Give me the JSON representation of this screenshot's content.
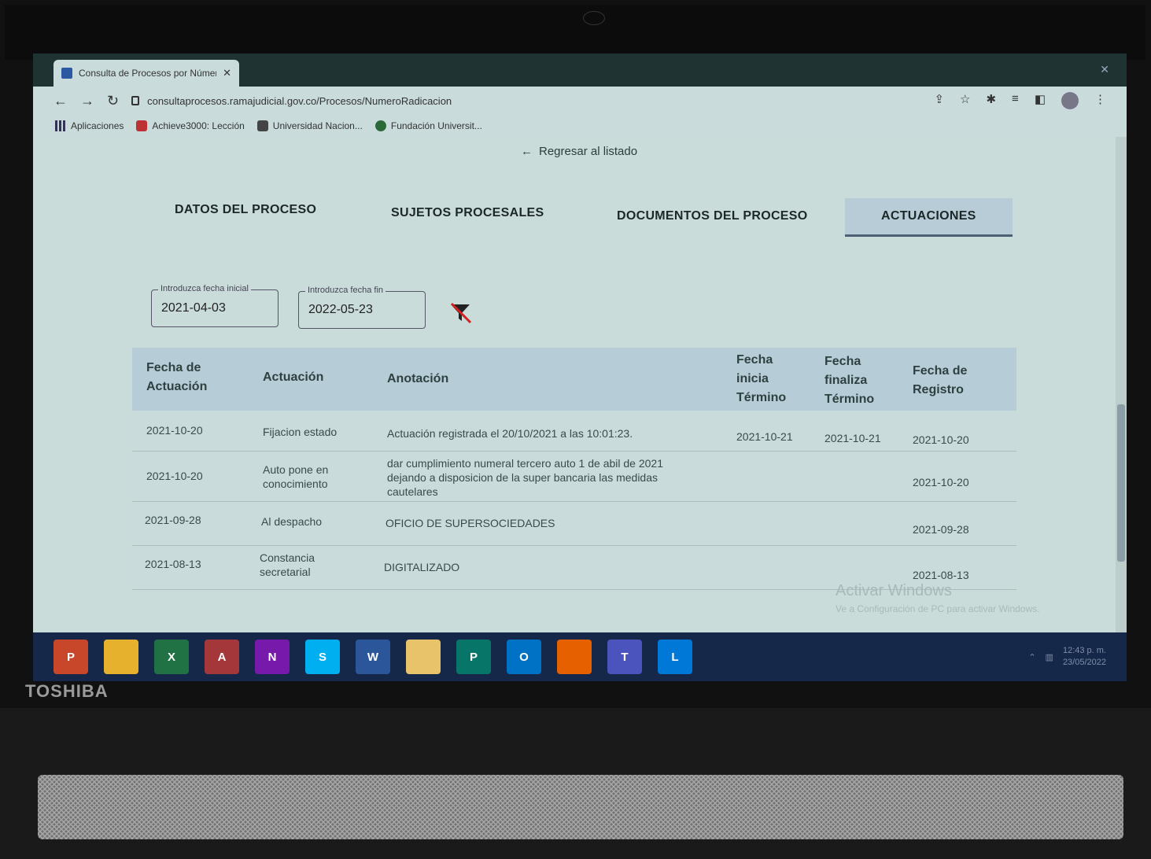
{
  "browser": {
    "tab_title": "Consulta de Procesos por Número",
    "url": "consultaprocesos.ramajudicial.gov.co/Procesos/NumeroRadicacion",
    "bookmarks": [
      "Aplicaciones",
      "Achieve3000: Lección",
      "Universidad Nacion...",
      "Fundación Universit..."
    ]
  },
  "page": {
    "back_link": "Regresar al listado",
    "tabs": [
      "DATOS DEL PROCESO",
      "SUJETOS PROCESALES",
      "DOCUMENTOS DEL PROCESO",
      "ACTUACIONES"
    ],
    "active_tab": "ACTUACIONES",
    "filters": {
      "start_label": "Introduzca fecha inicial",
      "start_value": "2021-04-03",
      "end_label": "Introduzca fecha fin",
      "end_value": "2022-05-23"
    },
    "table": {
      "headers": [
        "Fecha de\nActuación",
        "Actuación",
        "Anotación",
        "Fecha\ninicia\nTérmino",
        "Fecha\nfinaliza\nTérmino",
        "Fecha de\nRegistro"
      ],
      "rows": [
        [
          "2021-10-20",
          "Fijacion estado",
          "Actuación registrada el 20/10/2021 a las 10:01:23.",
          "2021-10-21",
          "2021-10-21",
          "2021-10-20"
        ],
        [
          "2021-10-20",
          "Auto pone en conocimiento",
          "dar cumplimiento numeral tercero auto 1 de abil de 2021 dejando a disposicion de la super bancaria las medidas cautelares",
          "",
          "",
          "2021-10-20"
        ],
        [
          "2021-09-28",
          "Al despacho",
          "OFICIO DE SUPERSOCIEDADES",
          "",
          "",
          "2021-09-28"
        ],
        [
          "2021-08-13",
          "Constancia secretarial",
          "DIGITALIZADO",
          "",
          "",
          "2021-08-13"
        ]
      ]
    }
  },
  "windows": {
    "watermark_title": "Activar Windows",
    "watermark_sub": "Ve a Configuración de PC para activar Windows.",
    "clock_time": "12:43 p. m.",
    "clock_date": "23/05/2022",
    "taskbar_apps": [
      {
        "name": "powerpoint-icon",
        "label": "P",
        "color": "#c8462a"
      },
      {
        "name": "chrome-icon",
        "label": "",
        "color": "#e6b12c"
      },
      {
        "name": "excel-icon",
        "label": "X",
        "color": "#207245"
      },
      {
        "name": "access-icon",
        "label": "A",
        "color": "#a4373a"
      },
      {
        "name": "onenote-icon",
        "label": "N",
        "color": "#7719aa"
      },
      {
        "name": "skype-icon",
        "label": "S",
        "color": "#00aff0"
      },
      {
        "name": "word-icon",
        "label": "W",
        "color": "#2b579a"
      },
      {
        "name": "file-explorer-icon",
        "label": "",
        "color": "#e8c36a"
      },
      {
        "name": "publisher-icon",
        "label": "P",
        "color": "#077568"
      },
      {
        "name": "outlook-icon",
        "label": "O",
        "color": "#0072c6"
      },
      {
        "name": "firefox-icon",
        "label": "",
        "color": "#e66000"
      },
      {
        "name": "teams-icon",
        "label": "T",
        "color": "#4b53bc"
      },
      {
        "name": "lync-icon",
        "label": "L",
        "color": "#0078d7"
      }
    ]
  },
  "device": {
    "brand": "TOSHIBA"
  }
}
